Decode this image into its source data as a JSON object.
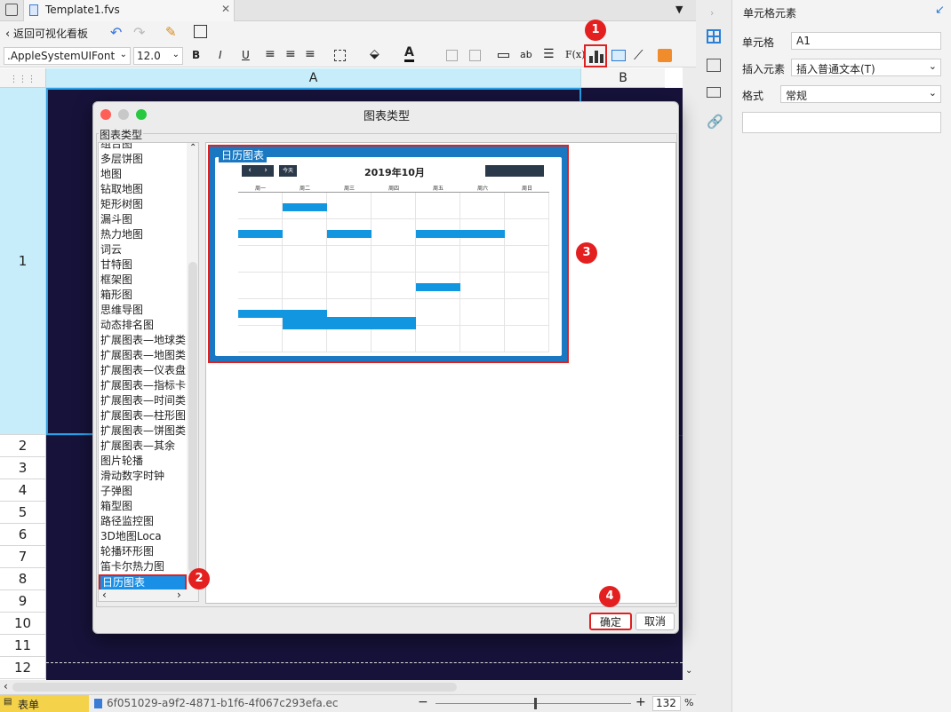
{
  "tabbar": {
    "tab_title": "Template1.fvs"
  },
  "toolbar": {
    "back_label": "返回可视化看板"
  },
  "format_bar": {
    "font_name": ".AppleSystemUIFont",
    "font_size": "12.0",
    "bold": "B",
    "italic": "I",
    "underline": "U",
    "fx": "F(x)",
    "ab": "ab"
  },
  "sheet": {
    "col_a": "A",
    "col_b": "B",
    "rows": [
      "1",
      "2",
      "3",
      "4",
      "5",
      "6",
      "7",
      "8",
      "9",
      "10",
      "11",
      "12"
    ]
  },
  "right_panel": {
    "title": "单元格元素",
    "cell_label": "单元格",
    "cell_value": "A1",
    "insert_label": "插入元素",
    "insert_value": "插入普通文本(T)",
    "format_label": "格式",
    "format_value": "常规"
  },
  "dialog": {
    "title": "图表类型",
    "group_label": "图表类型",
    "items": [
      "组合图",
      "多层饼图",
      "地图",
      "钻取地图",
      "矩形树图",
      "漏斗图",
      "热力地图",
      "词云",
      "甘特图",
      "框架图",
      "箱形图",
      "思维导图",
      "动态排名图",
      "扩展图表—地球类",
      "扩展图表—地图类",
      "扩展图表—仪表盘",
      "扩展图表—指标卡",
      "扩展图表—时间类",
      "扩展图表—柱形图",
      "扩展图表—饼图类",
      "扩展图表—其余",
      "图片轮播",
      "滑动数字时钟",
      "子弹图",
      "箱型图",
      "路径监控图",
      "3D地图Loca",
      "轮播环形图",
      "笛卡尔热力图",
      "日历图表"
    ],
    "selected": "日历图表",
    "preview_title": "日历图表",
    "calendar_month": "2019年10月",
    "today_btn": "今天",
    "week_days": [
      "周一",
      "周二",
      "周三",
      "周四",
      "周五",
      "周六",
      "周日"
    ],
    "ok_label": "确定",
    "cancel_label": "取消"
  },
  "badges": [
    "1",
    "2",
    "3",
    "4"
  ],
  "statusbar": {
    "sheet_tab": "表单",
    "file_id": "6f051029-a9f2-4871-b1f6-4f067c293efa.ec",
    "zoom": "132",
    "zoom_unit": "%"
  },
  "colors": {
    "accent": "#1296e0",
    "navy": "#16123a",
    "badge_red": "#e41f1f",
    "selected_bg": "#1a8fe6"
  }
}
